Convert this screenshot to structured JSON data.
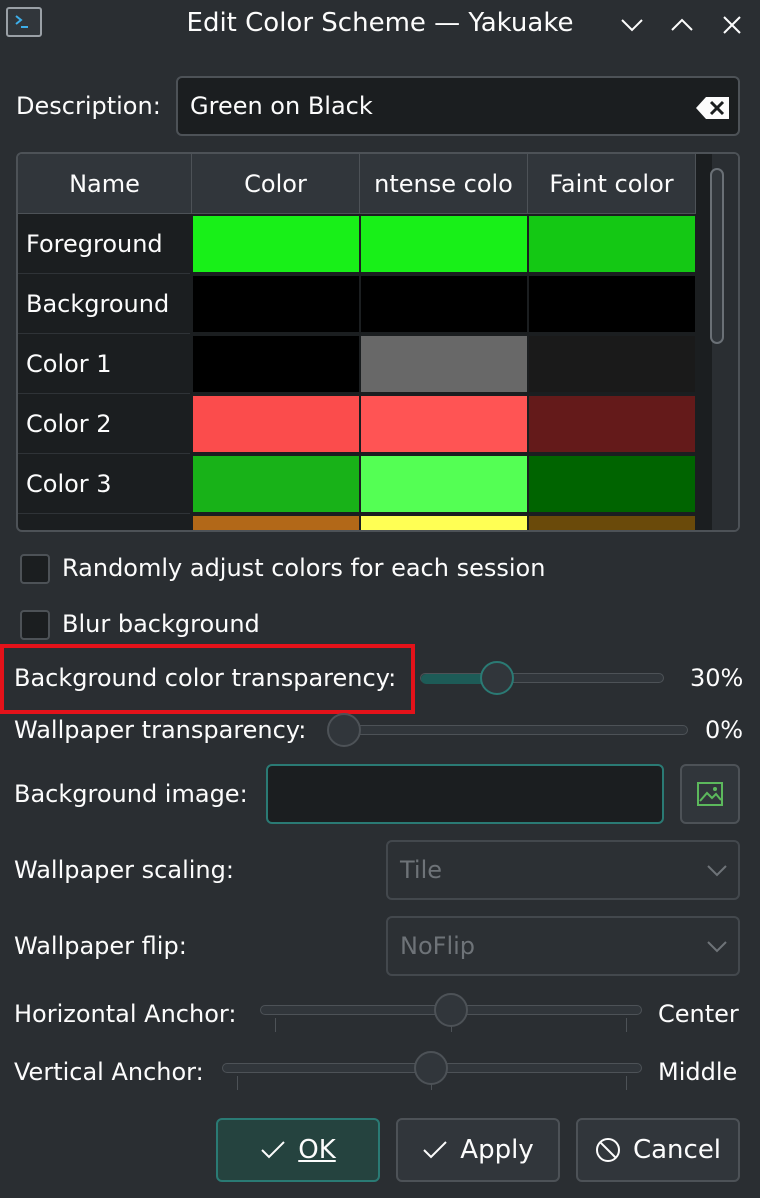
{
  "window": {
    "title": "Edit Color Scheme — Yakuake"
  },
  "description": {
    "label": "Description:",
    "value": "Green on Black"
  },
  "table": {
    "headers": [
      "Name",
      "Color",
      "ntense colo",
      "Faint color"
    ],
    "rows": [
      {
        "name": "Foreground",
        "colors": [
          "#18f018",
          "#18f018",
          "#14c814"
        ]
      },
      {
        "name": "Background",
        "colors": [
          "#000000",
          "#000000",
          "#000000"
        ]
      },
      {
        "name": "Color 1",
        "colors": [
          "#000000",
          "#686868",
          "#1a1a1a"
        ]
      },
      {
        "name": "Color 2",
        "colors": [
          "#fb4c4c",
          "#ff5454",
          "#641a1a"
        ]
      },
      {
        "name": "Color 3",
        "colors": [
          "#18b218",
          "#54ff54",
          "#006400"
        ]
      },
      {
        "name": "",
        "colors": [
          "#b26818",
          "#ffff54",
          "#6a4a0a"
        ]
      }
    ]
  },
  "options": {
    "random_label": "Randomly adjust colors for each session",
    "blur_label": "Blur background"
  },
  "bg_transparency": {
    "label": "Background color transparency:",
    "value": "30%",
    "fraction": 0.3
  },
  "wallpaper_transparency": {
    "label": "Wallpaper transparency:",
    "value": "0%",
    "fraction": 0.0
  },
  "background_image": {
    "label": "Background image:",
    "value": ""
  },
  "wallpaper_scaling": {
    "label": "Wallpaper scaling:",
    "value": "Tile"
  },
  "wallpaper_flip": {
    "label": "Wallpaper flip:",
    "value": "NoFlip"
  },
  "horizontal_anchor": {
    "label": "Horizontal Anchor:",
    "value": "Center"
  },
  "vertical_anchor": {
    "label": "Vertical Anchor:",
    "value": "Middle"
  },
  "buttons": {
    "ok": "OK",
    "apply": "Apply",
    "cancel": "Cancel"
  },
  "colors": {
    "accent": "#2a7a74",
    "highlight": "#e4121a"
  }
}
